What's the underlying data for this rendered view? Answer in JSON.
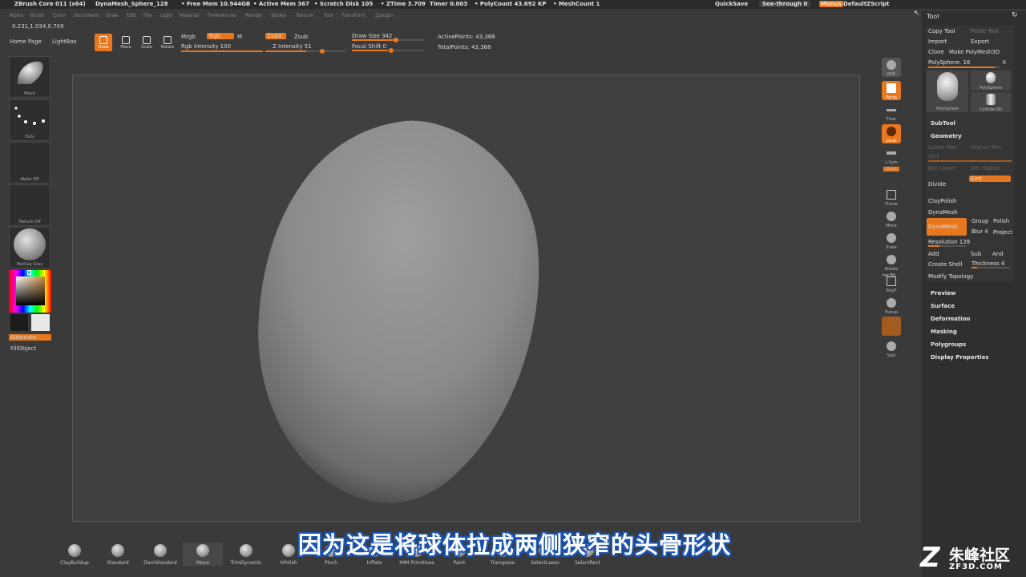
{
  "titlebar": {
    "app": "ZBrush Core 011 (x64)",
    "project": "DynaMesh_Sphere_128",
    "free_mem": "• Free Mem 10.944GB",
    "active_mem": "• Active Mem 367",
    "scratch": "• Scratch Disk 105",
    "ztime": "• ZTime 3.709",
    "timer": "Timer 0.003",
    "polycount": "• PolyCount 43.692 KP",
    "meshcount": "• MeshCount 1",
    "quicksave": "QuickSave",
    "see_through": "See-through  0",
    "menus": "Menus",
    "script": "DefaultZScript"
  },
  "menubar": [
    "Alpha",
    "Brush",
    "Color",
    "Document",
    "Draw",
    "Edit",
    "File",
    "Light",
    "Material",
    "Preferences",
    "Render",
    "Stroke",
    "Texture",
    "Tool",
    "Transform",
    "Zplugin"
  ],
  "coords": "0.231,1.034,0.709",
  "nav": {
    "home": "Home Page",
    "lightbox": "LightBox"
  },
  "tools": {
    "draw": "Draw",
    "move": "Move",
    "scale": "Scale",
    "rotate": "Rotate"
  },
  "toolbar": {
    "mrgb": "Mrgb",
    "rgb": "Rgb",
    "m": "M",
    "rgb_intensity": "Rgb Intensity 100",
    "zadd": "Zadd",
    "zsub": "Zsub",
    "z_intensity": "Z Intensity 51",
    "draw_size": "Draw Size 342",
    "focal_shift": "Focal Shift 0",
    "active_points": "ActivePoints: 43,368",
    "total_points": "TotalPoints: 43,368"
  },
  "left_shelf": {
    "brush": "Move",
    "stroke": "Dots",
    "alpha": "Alpha  Off",
    "texture": "Texture  Off",
    "material": "MatCap  Gray",
    "alternate": "Alternate",
    "fill": "FillObject"
  },
  "right_shelf": [
    "BPR",
    "Persp",
    "Floor",
    "Local",
    "L.Sym",
    "Qxyz",
    "Frame",
    "Move",
    "Scale",
    "Rotate",
    "PolyF",
    "Transp",
    "Solo"
  ],
  "right_shelf_extra": "Ine Fill",
  "panel": {
    "title": "Tool",
    "copy_tool": "Copy Tool",
    "paste_tool": "Paste Tool",
    "import": "Import",
    "export": "Export",
    "clone": "Clone",
    "make_polymesh": "Make PolyMesh3D",
    "polysphere_slider": "PolySphere. 16",
    "r": "R",
    "thumb_main": "PolySphere",
    "thumb_a": "PolySphere",
    "thumb_b": "Cylinder3D",
    "subtool": "SubTool",
    "geometry": "Geometry",
    "lower_res": "Lower Res",
    "higher_res": "Higher Res",
    "sdiv": "SDiv",
    "del_lower": "Del Lower",
    "del_higher": "Del Higher",
    "divide": "Divide",
    "smt": "Smt",
    "claypolish": "ClayPolish",
    "dynamesh_title": "DynaMesh",
    "dynamesh_btn": "DynaMesh",
    "group": "Group",
    "polish": "Polish",
    "blur": "Blur 4",
    "project": "Project",
    "resolution": "Resolution 128",
    "add": "Add",
    "sub": "Sub",
    "and": "And",
    "create_shell": "Create Shell",
    "thickness": "Thickness 4",
    "modify_topology": "Modify Topology",
    "sections": [
      "Preview",
      "Surface",
      "Deformation",
      "Masking",
      "Polygroups",
      "Display Properties"
    ]
  },
  "brushes": [
    "ClayBuildup",
    "Standard",
    "DamStandard",
    "Move",
    "TrimDynamic",
    "hPolish",
    "Pinch",
    "Inflate",
    "IMM Primitives",
    "Paint",
    "Transpose",
    "SelectLasso",
    "SelectRect"
  ],
  "subtitle": "因为这是将球体拉成两侧狭窄的头骨形状",
  "watermark": {
    "logo": "Z",
    "name": "朱峰社区",
    "domain": "ZF3D.COM"
  }
}
